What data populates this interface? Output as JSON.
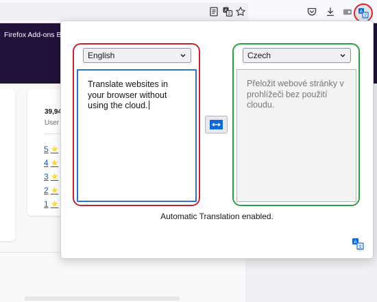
{
  "browser": {
    "toolbar_icons": [
      "reader-view-icon",
      "translate-page-icon",
      "bookmark-star-icon",
      "pocket-icon",
      "downloads-icon",
      "extension-icon",
      "automatic-translation-extension-icon"
    ]
  },
  "page": {
    "header_brand": "Firefox Add-ons B",
    "stats": {
      "users_count": "39,94",
      "users_label": "User"
    },
    "ratings": [
      "5",
      "4",
      "3",
      "2",
      "1"
    ]
  },
  "popup": {
    "source": {
      "language": "English",
      "text": "Translate websites in your browser without using the cloud."
    },
    "target": {
      "language": "Czech",
      "text": "Přeložit webové stránky v prohlížeči bez použití cloudu."
    },
    "swap_icon": "swap-arrows-icon",
    "status": "Automatic Translation enabled.",
    "highlight_colors": {
      "source_box": "#c8202d",
      "target_box": "#2aa13a",
      "toolbar_ring": "#d7262e"
    }
  }
}
